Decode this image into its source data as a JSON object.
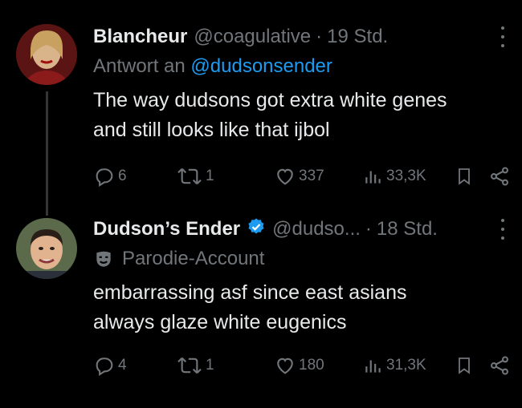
{
  "tweets": [
    {
      "name": "Blancheur",
      "handle": "@coagulative",
      "separator": "·",
      "time": "19 Std.",
      "reply_prefix": "Antwort an",
      "reply_mention": "@dudsonsender",
      "body_lines": [
        "The way dudsons got extra white genes",
        "and still looks like that ijbol"
      ],
      "replies": "6",
      "reposts": "1",
      "likes": "337",
      "views": "33,3K"
    },
    {
      "name": "Dudson’s Ender",
      "handle": "@dudso...",
      "separator": "·",
      "time": "18 Std.",
      "label": "Parodie-Account",
      "body_lines": [
        "embarrassing asf since east asians",
        "always glaze white eugenics"
      ],
      "replies": "4",
      "reposts": "1",
      "likes": "180",
      "views": "31,3K"
    }
  ],
  "colors": {
    "background": "#000000",
    "text": "#e7e9ea",
    "secondary": "#71767b",
    "link": "#1d9bf0"
  }
}
